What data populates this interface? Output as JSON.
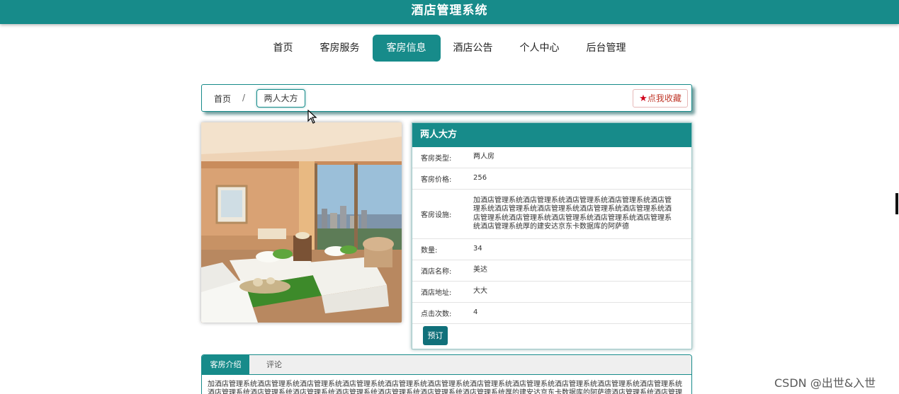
{
  "app": {
    "title": "酒店管理系统"
  },
  "nav": {
    "items": [
      {
        "label": "首页"
      },
      {
        "label": "客房服务"
      },
      {
        "label": "客房信息"
      },
      {
        "label": "酒店公告"
      },
      {
        "label": "个人中心"
      },
      {
        "label": "后台管理"
      }
    ],
    "active_index": 2
  },
  "breadcrumb": {
    "home": "首页",
    "separator": "/",
    "current": "两人大方"
  },
  "favorite": {
    "label": "点我收藏",
    "icon": "star-icon"
  },
  "room": {
    "name": "两人大方",
    "fields": [
      {
        "key": "客房类型:",
        "value": "两人房"
      },
      {
        "key": "客房价格:",
        "value": "256"
      },
      {
        "key": "客房设施:",
        "value": "加酒店管理系统酒店管理系统酒店管理系统酒店管理系统酒店管理系统酒店管理系统酒店管理系统酒店管理系统酒店管理系统酒店管理系统酒店管理系统酒店管理系统酒店管理系统酒店管理系统酒店管理系统厚的建安达京东卡数据库的阿萨德"
      },
      {
        "key": "数量:",
        "value": "34"
      },
      {
        "key": "酒店名称:",
        "value": "美达"
      },
      {
        "key": "酒店地址:",
        "value": "大大"
      },
      {
        "key": "点击次数:",
        "value": "4"
      }
    ],
    "book_label": "预订"
  },
  "tabs": {
    "items": [
      {
        "label": "客房介绍"
      },
      {
        "label": "评论"
      }
    ],
    "active_index": 0,
    "intro_text": "加酒店管理系统酒店管理系统酒店管理系统酒店管理系统酒店管理系统酒店管理系统酒店管理系统酒店管理系统酒店管理系统酒店管理系统酒店管理系统酒店管理系统酒店管理系统酒店管理系统酒店管理系统酒店管理系统酒店管理系统酒店管理系统厚的建安达京东卡数据库的阿萨德酒店管理系统酒店管理系统酒店管理系统酒店管理系统酒店管理系统"
  },
  "watermark": "CSDN @出世&入世",
  "colors": {
    "primary": "#178b8a",
    "dark_button": "#10707a",
    "favorite_red": "#d0021b"
  }
}
